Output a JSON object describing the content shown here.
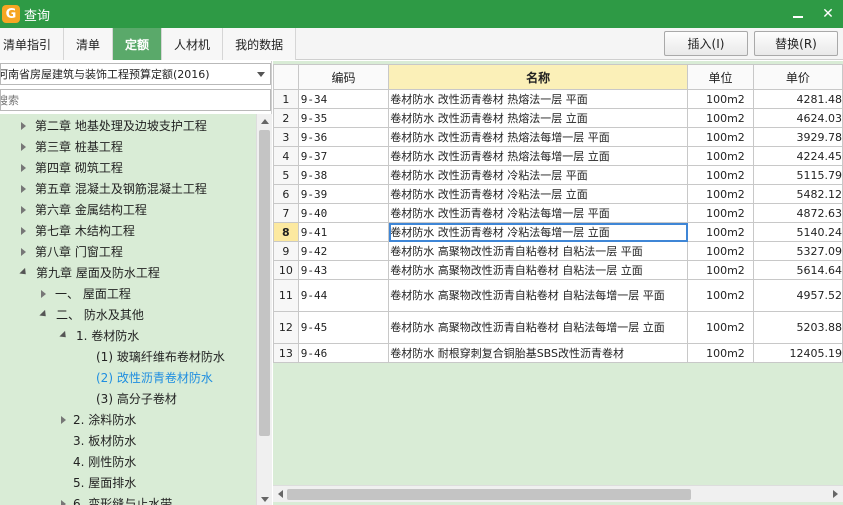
{
  "window": {
    "title": "查询",
    "logo_glyph": "G",
    "minimize_icon": "minimize-icon",
    "close_glyph": "✕"
  },
  "tabs": [
    {
      "label": "清单指引"
    },
    {
      "label": "清单"
    },
    {
      "label": "定额",
      "active": true
    },
    {
      "label": "人材机"
    },
    {
      "label": "我的数据"
    }
  ],
  "actions": {
    "insert_label": "插入(I)",
    "replace_label": "替换(R)"
  },
  "left_panel": {
    "quota_library": "河南省房屋建筑与装饰工程预算定额(2016)",
    "search_placeholder": "搜索",
    "tree": [
      {
        "label": "第二章 地基处理及边坡支护工程",
        "level": 0,
        "state": "collapsed"
      },
      {
        "label": "第三章 桩基工程",
        "level": 0,
        "state": "collapsed"
      },
      {
        "label": "第四章 砌筑工程",
        "level": 0,
        "state": "collapsed"
      },
      {
        "label": "第五章 混凝土及钢筋混凝土工程",
        "level": 0,
        "state": "collapsed"
      },
      {
        "label": "第六章 金属结构工程",
        "level": 0,
        "state": "collapsed"
      },
      {
        "label": "第七章 木结构工程",
        "level": 0,
        "state": "collapsed"
      },
      {
        "label": "第八章 门窗工程",
        "level": 0,
        "state": "collapsed"
      },
      {
        "label": "第九章 屋面及防水工程",
        "level": 0,
        "state": "expanded"
      },
      {
        "label": "一、 屋面工程",
        "level": 1,
        "state": "collapsed"
      },
      {
        "label": "二、 防水及其他",
        "level": 1,
        "state": "expanded"
      },
      {
        "label": "1. 卷材防水",
        "level": 2,
        "state": "expanded"
      },
      {
        "label": "(1) 玻璃纤维布卷材防水",
        "level": 3,
        "state": "leaf"
      },
      {
        "label": "(2) 改性沥青卷材防水",
        "level": 3,
        "state": "leaf",
        "selected": true
      },
      {
        "label": "(3) 高分子卷材",
        "level": 3,
        "state": "leaf"
      },
      {
        "label": "2. 涂料防水",
        "level": 2,
        "state": "collapsed"
      },
      {
        "label": "3. 板材防水",
        "level": 2,
        "state": "leaf"
      },
      {
        "label": "4. 刚性防水",
        "level": 2,
        "state": "leaf"
      },
      {
        "label": "5. 屋面排水",
        "level": 2,
        "state": "leaf"
      },
      {
        "label": "6. 变形缝与止水带",
        "level": 2,
        "state": "collapsed"
      }
    ]
  },
  "grid": {
    "columns": [
      "",
      "编码",
      "名称",
      "单位",
      "单价"
    ],
    "selected_row": 8,
    "rows": [
      {
        "no": "1",
        "code": "9-34",
        "name": "卷材防水 改性沥青卷材 热熔法一层 平面",
        "unit": "100m2",
        "price": "4281.48"
      },
      {
        "no": "2",
        "code": "9-35",
        "name": "卷材防水 改性沥青卷材 热熔法一层 立面",
        "unit": "100m2",
        "price": "4624.03"
      },
      {
        "no": "3",
        "code": "9-36",
        "name": "卷材防水 改性沥青卷材 热熔法每增一层 平面",
        "unit": "100m2",
        "price": "3929.78"
      },
      {
        "no": "4",
        "code": "9-37",
        "name": "卷材防水 改性沥青卷材 热熔法每增一层 立面",
        "unit": "100m2",
        "price": "4224.45"
      },
      {
        "no": "5",
        "code": "9-38",
        "name": "卷材防水 改性沥青卷材 冷粘法一层 平面",
        "unit": "100m2",
        "price": "5115.79"
      },
      {
        "no": "6",
        "code": "9-39",
        "name": "卷材防水 改性沥青卷材 冷粘法一层 立面",
        "unit": "100m2",
        "price": "5482.12"
      },
      {
        "no": "7",
        "code": "9-40",
        "name": "卷材防水 改性沥青卷材 冷粘法每增一层 平面",
        "unit": "100m2",
        "price": "4872.63"
      },
      {
        "no": "8",
        "code": "9-41",
        "name": "卷材防水 改性沥青卷材 冷粘法每增一层 立面",
        "unit": "100m2",
        "price": "5140.24"
      },
      {
        "no": "9",
        "code": "9-42",
        "name": "卷材防水 高聚物改性沥青自粘卷材 自粘法一层 平面",
        "unit": "100m2",
        "price": "5327.09"
      },
      {
        "no": "10",
        "code": "9-43",
        "name": "卷材防水 高聚物改性沥青自粘卷材 自粘法一层 立面",
        "unit": "100m2",
        "price": "5614.64"
      },
      {
        "no": "11",
        "code": "9-44",
        "name": "卷材防水 高聚物改性沥青自粘卷材 自粘法每增一层 平面",
        "unit": "100m2",
        "price": "4957.52"
      },
      {
        "no": "12",
        "code": "9-45",
        "name": "卷材防水 高聚物改性沥青自粘卷材 自粘法每增一层 立面",
        "unit": "100m2",
        "price": "5203.88"
      },
      {
        "no": "13",
        "code": "9-46",
        "name": "卷材防水 耐根穿刺复合铜胎基SBS改性沥青卷材",
        "unit": "100m2",
        "price": "12405.19"
      }
    ]
  }
}
